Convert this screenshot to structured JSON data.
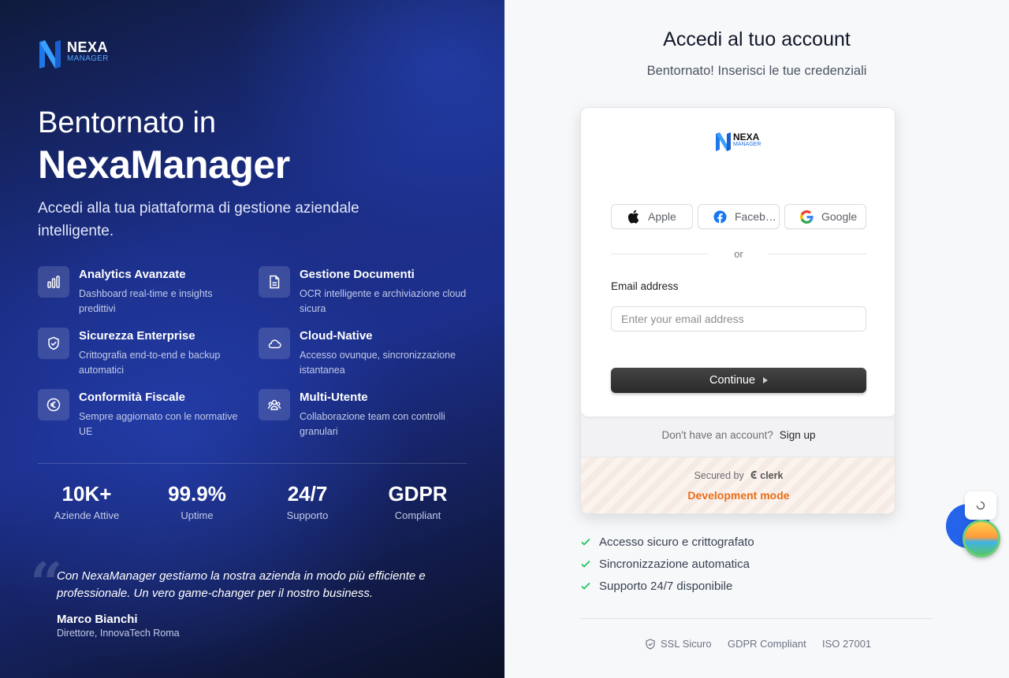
{
  "brand": {
    "logo_top": "NEXA",
    "logo_bottom": "MANAGER"
  },
  "hero": {
    "line1": "Bentornato in",
    "line2": "NexaManager",
    "subtitle": "Accedi alla tua piattaforma di gestione aziendale intelligente."
  },
  "features": [
    {
      "title": "Analytics Avanzate",
      "desc": "Dashboard real-time e insights predittivi",
      "icon": "bar-chart-icon"
    },
    {
      "title": "Gestione Documenti",
      "desc": "OCR intelligente e archiviazione cloud sicura",
      "icon": "document-icon"
    },
    {
      "title": "Sicurezza Enterprise",
      "desc": "Crittografia end-to-end e backup automatici",
      "icon": "shield-check-icon"
    },
    {
      "title": "Cloud-Native",
      "desc": "Accesso ovunque, sincronizzazione istantanea",
      "icon": "cloud-icon"
    },
    {
      "title": "Conformità Fiscale",
      "desc": "Sempre aggiornato con le normative UE",
      "icon": "euro-icon"
    },
    {
      "title": "Multi-Utente",
      "desc": "Collaborazione team con controlli granulari",
      "icon": "users-icon"
    }
  ],
  "stats": [
    {
      "value": "10K+",
      "label": "Aziende Attive"
    },
    {
      "value": "99.9%",
      "label": "Uptime"
    },
    {
      "value": "24/7",
      "label": "Supporto"
    },
    {
      "value": "GDPR",
      "label": "Compliant"
    }
  ],
  "testimonial": {
    "quote": "Con NexaManager gestiamo la nostra azienda in modo più efficiente e professionale. Un vero game-changer per il nostro business.",
    "author": "Marco Bianchi",
    "role": "Direttore, InnovaTech Roma"
  },
  "login": {
    "title": "Accedi al tuo account",
    "subtitle": "Bentornato! Inserisci le tue credenziali",
    "card_logo_top": "NEXA",
    "card_logo_bottom": "MANAGER",
    "social": [
      {
        "label": "Apple",
        "icon": "apple-icon"
      },
      {
        "label": "Facebook",
        "icon": "facebook-icon"
      },
      {
        "label": "Google",
        "icon": "google-icon"
      }
    ],
    "or": "or",
    "email_label": "Email address",
    "email_placeholder": "Enter your email address",
    "email_value": "",
    "continue_label": "Continue",
    "no_account": "Don't have an account?",
    "sign_up": "Sign up",
    "secured_by": "Secured by",
    "clerk": "clerk",
    "dev_mode": "Development mode"
  },
  "checks": [
    "Accesso sicuro e crittografato",
    "Sincronizzazione automatica",
    "Supporto 24/7 disponibile"
  ],
  "badges": [
    "SSL Sicuro",
    "GDPR Compliant",
    "ISO 27001"
  ],
  "colors": {
    "accent_blue": "#2563eb",
    "dev_orange": "#ea6d16",
    "check_green": "#22c55e"
  }
}
